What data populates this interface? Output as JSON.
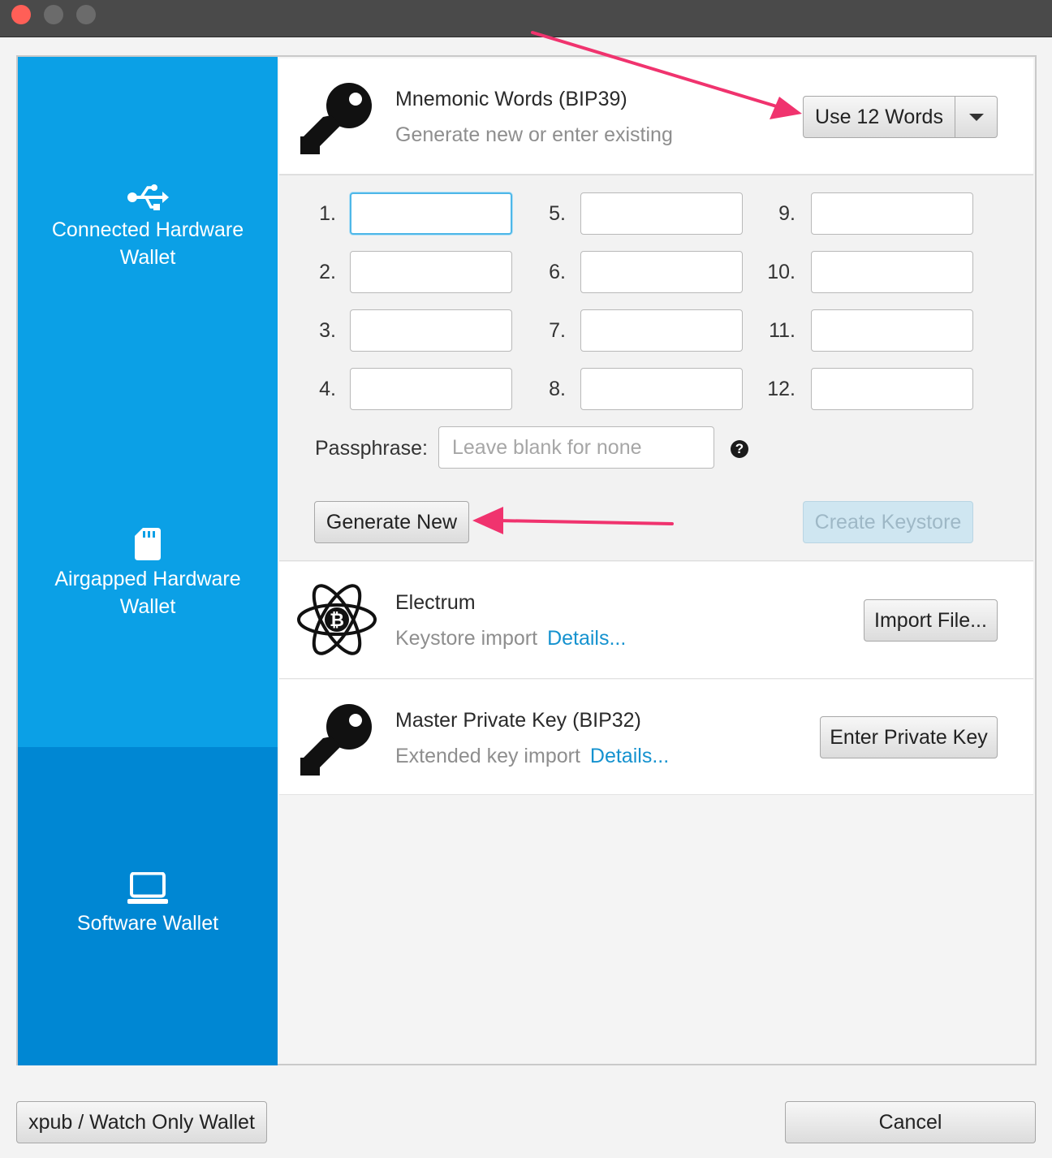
{
  "sidebar": {
    "items": [
      {
        "label": "Connected Hardware Wallet",
        "icon": "usb-icon"
      },
      {
        "label": "Airgapped Hardware Wallet",
        "icon": "sd-card-icon"
      },
      {
        "label": "Software Wallet",
        "icon": "laptop-icon",
        "selected": true
      }
    ]
  },
  "mnemonic": {
    "title": "Mnemonic Words (BIP39)",
    "subtitle": "Generate new or enter existing",
    "word_count_button": "Use 12 Words",
    "word_labels": [
      "1.",
      "2.",
      "3.",
      "4.",
      "5.",
      "6.",
      "7.",
      "8.",
      "9.",
      "10.",
      "11.",
      "12."
    ],
    "passphrase_label": "Passphrase:",
    "passphrase_placeholder": "Leave blank for none",
    "generate_button": "Generate New",
    "create_button": "Create Keystore"
  },
  "electrum": {
    "title": "Electrum",
    "subtitle": "Keystore import",
    "link": "Details...",
    "button": "Import File..."
  },
  "master_key": {
    "title": "Master Private Key (BIP32)",
    "subtitle": "Extended key import",
    "link": "Details...",
    "button": "Enter Private Key"
  },
  "footer": {
    "watch_only_button": "xpub / Watch Only Wallet",
    "cancel_button": "Cancel"
  },
  "colors": {
    "sidebar": "#0ba0e6",
    "sidebar_selected": "#0087d3",
    "link": "#1592cf",
    "annotation_arrow": "#f0336e"
  }
}
